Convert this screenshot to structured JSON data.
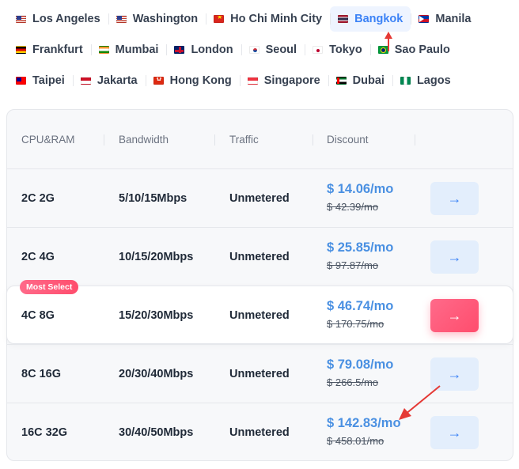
{
  "locations": [
    [
      {
        "label": "Los Angeles",
        "flag": "us-flag-icon",
        "flag_class": "flag-us",
        "active": false
      },
      {
        "label": "Washington",
        "flag": "us-flag-icon",
        "flag_class": "flag-us",
        "active": false
      },
      {
        "label": "Ho Chi Minh City",
        "flag": "vietnam-flag-icon",
        "flag_class": "flag-vn",
        "active": false
      },
      {
        "label": "Bangkok",
        "flag": "thailand-flag-icon",
        "flag_class": "flag-th",
        "active": true
      },
      {
        "label": "Manila",
        "flag": "philippines-flag-icon",
        "flag_class": "flag-ph",
        "active": false
      }
    ],
    [
      {
        "label": "Frankfurt",
        "flag": "germany-flag-icon",
        "flag_class": "flag-de",
        "active": false
      },
      {
        "label": "Mumbai",
        "flag": "india-flag-icon",
        "flag_class": "flag-in",
        "active": false
      },
      {
        "label": "London",
        "flag": "uk-flag-icon",
        "flag_class": "flag-gb",
        "active": false
      },
      {
        "label": "Seoul",
        "flag": "korea-flag-icon",
        "flag_class": "flag-kr",
        "active": false
      },
      {
        "label": "Tokyo",
        "flag": "japan-flag-icon",
        "flag_class": "flag-jp",
        "active": false
      },
      {
        "label": "Sao Paulo",
        "flag": "brazil-flag-icon",
        "flag_class": "flag-br",
        "active": false
      }
    ],
    [
      {
        "label": "Taipei",
        "flag": "taiwan-flag-icon",
        "flag_class": "flag-tw",
        "active": false
      },
      {
        "label": "Jakarta",
        "flag": "indonesia-flag-icon",
        "flag_class": "flag-id",
        "active": false
      },
      {
        "label": "Hong Kong",
        "flag": "hongkong-flag-icon",
        "flag_class": "flag-hk",
        "active": false
      },
      {
        "label": "Singapore",
        "flag": "singapore-flag-icon",
        "flag_class": "flag-sg",
        "active": false
      },
      {
        "label": "Dubai",
        "flag": "uae-flag-icon",
        "flag_class": "flag-ae",
        "active": false
      },
      {
        "label": "Lagos",
        "flag": "nigeria-flag-icon",
        "flag_class": "flag-ng",
        "active": false
      }
    ]
  ],
  "table": {
    "headers": [
      "CPU&RAM",
      "Bandwidth",
      "Traffic",
      "Discount"
    ],
    "rows": [
      {
        "cpu_ram": "2C 2G",
        "bandwidth": "5/10/15Mbps",
        "traffic": "Unmetered",
        "price": "$ 14.06/mo",
        "old_price": "$ 42.39/mo",
        "featured": false
      },
      {
        "cpu_ram": "2C 4G",
        "bandwidth": "10/15/20Mbps",
        "traffic": "Unmetered",
        "price": "$ 25.85/mo",
        "old_price": "$ 97.87/mo",
        "featured": false
      },
      {
        "cpu_ram": "4C 8G",
        "bandwidth": "15/20/30Mbps",
        "traffic": "Unmetered",
        "price": "$ 46.74/mo",
        "old_price": "$ 170.75/mo",
        "featured": true,
        "badge": "Most Select"
      },
      {
        "cpu_ram": "8C 16G",
        "bandwidth": "20/30/40Mbps",
        "traffic": "Unmetered",
        "price": "$ 79.08/mo",
        "old_price": "$ 266.5/mo",
        "featured": false
      },
      {
        "cpu_ram": "16C 32G",
        "bandwidth": "30/40/50Mbps",
        "traffic": "Unmetered",
        "price": "$ 142.83/mo",
        "old_price": "$ 458.01/mo",
        "featured": false
      }
    ],
    "action_icon": "arrow-right-icon",
    "action_glyph": "→"
  },
  "colors": {
    "accent": "#3b82f6",
    "price": "#4a90e2",
    "featured": "#ff4d6d",
    "annotation": "#e53935"
  }
}
